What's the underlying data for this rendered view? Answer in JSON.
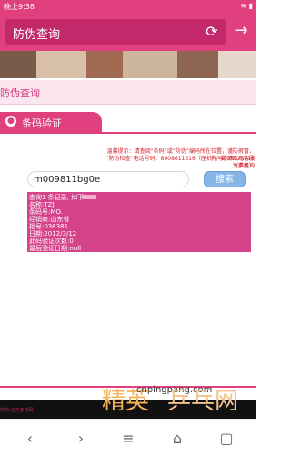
{
  "status_bar": {
    "time": "晚上9:38",
    "indicators": "wifi battery 68"
  },
  "browser": {
    "address_text": "防伪查询",
    "icons": [
      "refresh-icon",
      "arrow-right-icon"
    ]
  },
  "page": {
    "title": "防伪查询",
    "section_label": "条码验证",
    "hints": [
      "温馨提示：请查阅“条码”或“防伪”编码所在位置，谨防假冒，有问题请致电客服",
      "“防伪检查”电话号码：8008611316（座机），4006723316（手机）",
      "免费查询"
    ],
    "search": {
      "value": "m009811bg0e",
      "button_label": "搜索"
    },
    "result": {
      "header": "查询1 条记录, 如下:",
      "lines": [
        "名称:TZJ",
        "条码号:MO.",
        "经销商:山东省",
        "批号:036381",
        "日期:2012/3/12",
        "此码验证次数:0",
        "最后验证日期:null"
      ]
    }
  },
  "watermark": {
    "brand": "精英",
    "domain": "cnpingpang.com",
    "name": "乒乓网"
  },
  "footer": {
    "text": "优商:全力支持网"
  },
  "nav": {
    "icons": [
      "back-icon",
      "forward-icon",
      "menu-icon",
      "home-icon",
      "tabs-icon"
    ]
  }
}
